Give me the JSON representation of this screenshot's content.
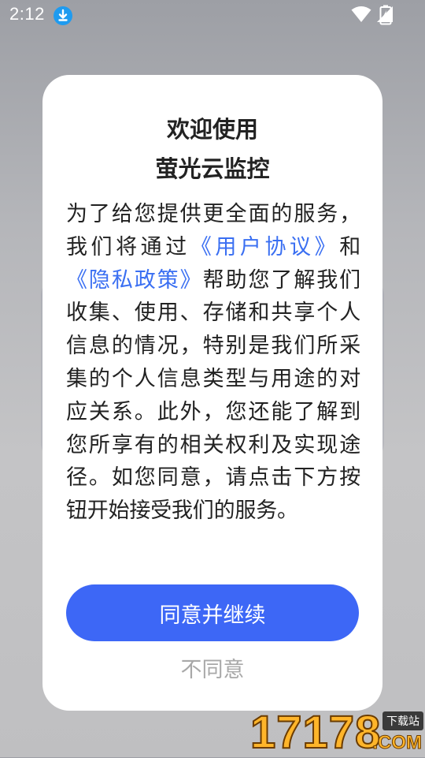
{
  "status_bar": {
    "time": "2:12",
    "icons": [
      "download-icon",
      "wifi-icon",
      "cell-signal-icon",
      "battery-charging-icon"
    ]
  },
  "dialog": {
    "title_line1": "欢迎使用",
    "title_line2": "萤光云监控",
    "body": {
      "p1": "为了给您提供更全面的服务，我们将通过",
      "link_user_agreement": "《用户协议》",
      "and": "和",
      "link_privacy_policy": "《隐私政策》",
      "p2": "帮助您了解我们收集、使用、存储和共享个人信息的情况，特别是我们所采集的个人信息类型与用途的对应关系。此外，您还能了解到您所享有的相关权利及实现途径。如您同意，请点击下方按钮开始接受我们的服务。"
    },
    "agree_label": "同意并继续",
    "disagree_label": "不同意"
  },
  "watermark": {
    "digits": "17178",
    "badge": "下载站",
    "suffix": ".COM"
  },
  "colors": {
    "primary_button": "#3d67f6",
    "link": "#3a6ff2",
    "disagree_text": "#a8a8a8",
    "status_download": "#1e9bf0"
  }
}
